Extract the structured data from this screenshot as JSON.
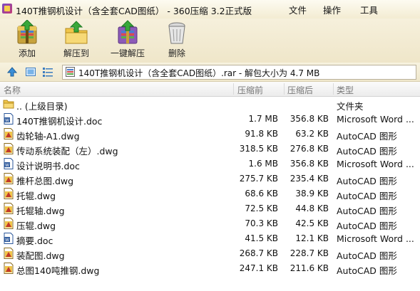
{
  "window": {
    "title": "140T推钢机设计（含全套CAD图纸） - 360压缩 3.2正式版",
    "menus": [
      "文件",
      "操作",
      "工具"
    ]
  },
  "toolbar": {
    "add_label": "添加",
    "extract_to_label": "解压到",
    "one_click_label": "一键解压",
    "delete_label": "删除"
  },
  "addressbar": {
    "path": "140T推钢机设计（含全套CAD图纸）.rar - 解包大小为 4.7 MB"
  },
  "columns": {
    "name": "名称",
    "size": "压缩前",
    "packed": "压缩后",
    "type": "类型"
  },
  "parent": {
    "name": ".. (上级目录)",
    "type": "文件夹"
  },
  "files": [
    {
      "name": "140T推钢机设计.doc",
      "size": "1.7 MB",
      "packed": "356.8 KB",
      "type": "Microsoft Word ...",
      "icon": "word-doc-icon"
    },
    {
      "name": "齿轮轴-A1.dwg",
      "size": "91.8 KB",
      "packed": "63.2 KB",
      "type": "AutoCAD 图形",
      "icon": "dwg-file-icon"
    },
    {
      "name": "传动系统装配（左）.dwg",
      "size": "318.5 KB",
      "packed": "276.8 KB",
      "type": "AutoCAD 图形",
      "icon": "dwg-file-icon"
    },
    {
      "name": "设计说明书.doc",
      "size": "1.6 MB",
      "packed": "356.8 KB",
      "type": "Microsoft Word ...",
      "icon": "word-doc-icon"
    },
    {
      "name": "推杆总图.dwg",
      "size": "275.7 KB",
      "packed": "235.4 KB",
      "type": "AutoCAD 图形",
      "icon": "dwg-file-icon"
    },
    {
      "name": "托辊.dwg",
      "size": "68.6 KB",
      "packed": "38.9 KB",
      "type": "AutoCAD 图形",
      "icon": "dwg-file-icon"
    },
    {
      "name": "托辊轴.dwg",
      "size": "72.5 KB",
      "packed": "44.8 KB",
      "type": "AutoCAD 图形",
      "icon": "dwg-file-icon"
    },
    {
      "name": "压辊.dwg",
      "size": "70.3 KB",
      "packed": "42.5 KB",
      "type": "AutoCAD 图形",
      "icon": "dwg-file-icon"
    },
    {
      "name": "摘要.doc",
      "size": "41.5 KB",
      "packed": "12.1 KB",
      "type": "Microsoft Word ...",
      "icon": "word-doc-icon"
    },
    {
      "name": "装配图.dwg",
      "size": "268.7 KB",
      "packed": "228.7 KB",
      "type": "AutoCAD 图形",
      "icon": "dwg-file-icon"
    },
    {
      "name": "总图140吨推钢.dwg",
      "size": "247.1 KB",
      "packed": "211.6 KB",
      "type": "AutoCAD 图形",
      "icon": "dwg-file-icon"
    }
  ]
}
